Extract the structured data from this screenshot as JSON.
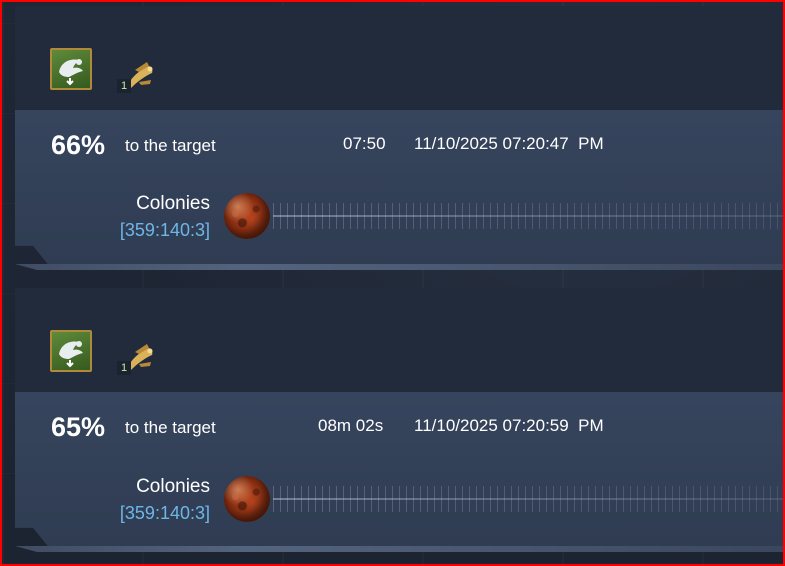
{
  "fleets": [
    {
      "mission_icon": "harvest-recycle-icon",
      "ship_icon": "recycler-ship-icon",
      "ship_count": "1",
      "percent": "66%",
      "percent_value": 0.66,
      "target_label": "to the target",
      "duration": "07:50",
      "arrival": "11/10/2025 07:20:47  PM",
      "destination": {
        "name": "Colonies",
        "coords": "[359:140:3]",
        "icon": "red-planet-icon"
      }
    },
    {
      "mission_icon": "harvest-recycle-icon",
      "ship_icon": "recycler-ship-icon",
      "ship_count": "1",
      "percent": "65%",
      "percent_value": 0.65,
      "target_label": "to the target",
      "duration": "08m 02s",
      "arrival": "11/10/2025 07:20:59  PM",
      "destination": {
        "name": "Colonies",
        "coords": "[359:140:3]",
        "icon": "red-planet-icon"
      }
    }
  ],
  "colors": {
    "frame_border": "#ff0000",
    "coords_text": "#6fb6e8",
    "mission_icon_bg": "#4e7a30",
    "mission_icon_border": "#b08a3a",
    "planet": "#a83a18"
  }
}
